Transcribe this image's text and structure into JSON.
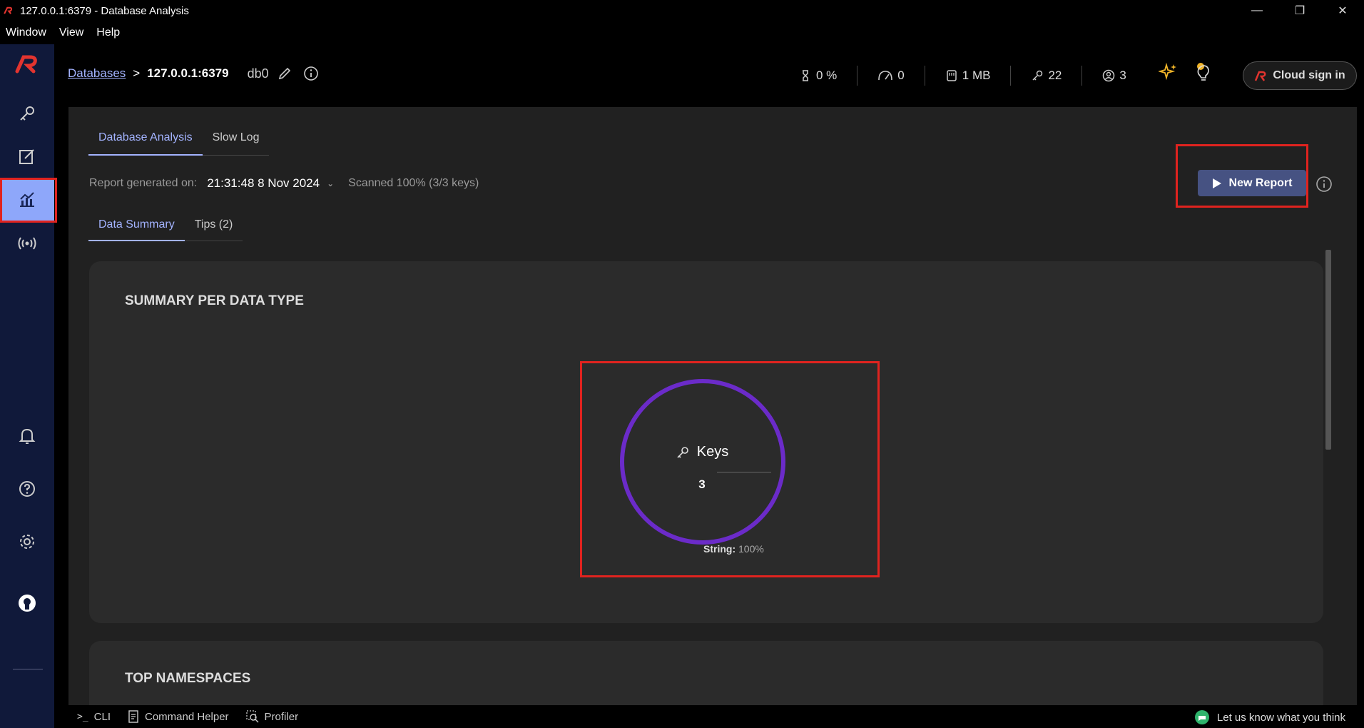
{
  "window": {
    "title": "127.0.0.1:6379 - Database Analysis"
  },
  "menu": [
    "Window",
    "View",
    "Help"
  ],
  "sidebar": {
    "items": [
      {
        "name": "browser",
        "icon": "key-icon"
      },
      {
        "name": "workbench",
        "icon": "edit-icon"
      },
      {
        "name": "analysis",
        "icon": "chart-icon",
        "active": true
      },
      {
        "name": "pubsub",
        "icon": "broadcast-icon"
      }
    ],
    "bottom": [
      "bell-icon",
      "help-icon",
      "gear-icon",
      "github-icon"
    ]
  },
  "header": {
    "breadcrumb_link": "Databases",
    "breadcrumb_sep": ">",
    "host": "127.0.0.1:6379",
    "db": "db0",
    "stats": [
      {
        "icon": "cpu-icon",
        "value": "0 %"
      },
      {
        "icon": "gauge-icon",
        "value": "0"
      },
      {
        "icon": "memory-icon",
        "value": "1 MB"
      },
      {
        "icon": "key-icon",
        "value": "22"
      },
      {
        "icon": "user-icon",
        "value": "3"
      }
    ],
    "cloud_signin": "Cloud sign in"
  },
  "main": {
    "tabs": [
      "Database Analysis",
      "Slow Log"
    ],
    "report_label": "Report generated on:",
    "report_time": "21:31:48 8 Nov 2024",
    "scanned": "Scanned 100% (3/3 keys)",
    "new_report": "New Report",
    "subtabs": [
      "Data Summary",
      "Tips (2)"
    ],
    "summary_title": "SUMMARY PER DATA TYPE",
    "keys_label": "Keys",
    "keys_count": "3",
    "legend_label": "String:",
    "legend_value": "100%",
    "namespaces_title": "TOP NAMESPACES",
    "accent": "#6b2bc9"
  },
  "bottom": {
    "cli": "CLI",
    "command_helper": "Command Helper",
    "profiler": "Profiler",
    "feedback": "Let us know what you think"
  },
  "chart_data": {
    "type": "pie",
    "categories": [
      "String"
    ],
    "values": [
      100
    ]
  }
}
